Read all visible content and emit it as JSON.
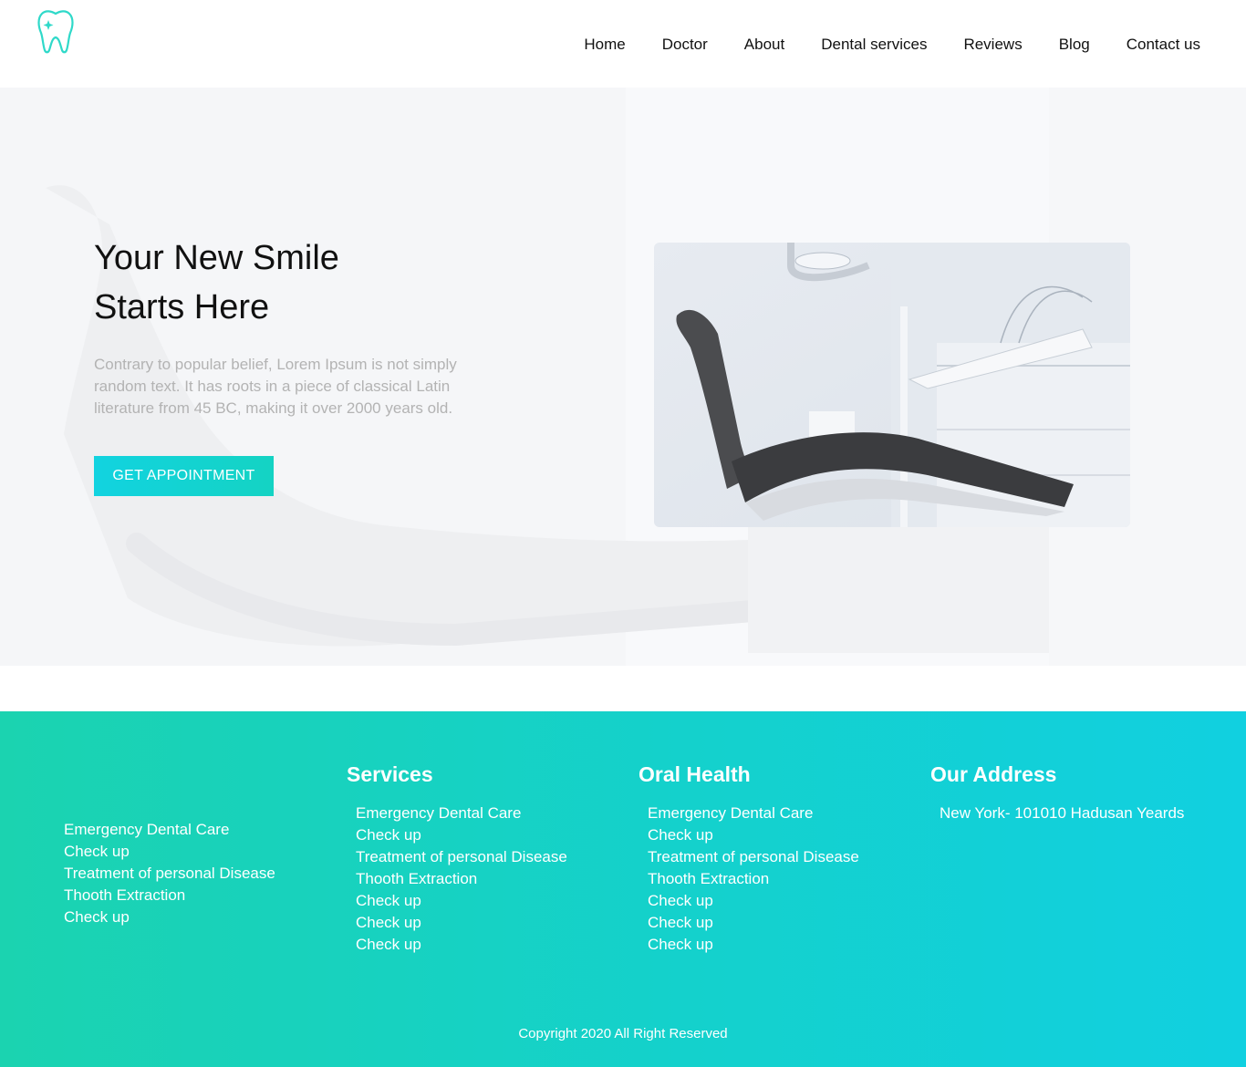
{
  "header": {
    "nav": [
      "Home",
      "Doctor",
      "About",
      "Dental services",
      "Reviews",
      "Blog",
      "Contact us"
    ]
  },
  "hero": {
    "title_line1": "Your New Smile",
    "title_line2": "Starts Here",
    "description": "Contrary to popular belief, Lorem Ipsum is not simply random text. It has roots in a piece of classical Latin literature from 45 BC, making it over 2000 years old.",
    "cta_label": "GET APPOINTMENT"
  },
  "footer": {
    "col1_items": [
      "Emergency Dental Care",
      "Check up",
      "Treatment of personal Disease",
      "Thooth Extraction",
      "Check up"
    ],
    "services": {
      "title": "Services",
      "items": [
        "Emergency Dental Care",
        "Check up",
        "Treatment of personal Disease",
        "Thooth Extraction",
        "Check up",
        "Check up",
        "Check up"
      ]
    },
    "oral_health": {
      "title": "Oral Health",
      "items": [
        "Emergency Dental Care",
        "Check up",
        "Treatment of personal Disease",
        "Thooth Extraction",
        "Check up",
        "Check up",
        "Check up"
      ]
    },
    "address": {
      "title": "Our Address",
      "items": [
        "New York- 101010 Hadusan Yeards"
      ]
    },
    "copyright": "Copyright 2020 All Right Reserved"
  },
  "colors": {
    "accent": "#14d3c3",
    "footer_gradient_start": "#1bd3b0",
    "footer_gradient_end": "#11d0e0",
    "hero_bg": "#f4f5f7"
  },
  "icons": {
    "logo": "tooth-sparkle-icon"
  }
}
